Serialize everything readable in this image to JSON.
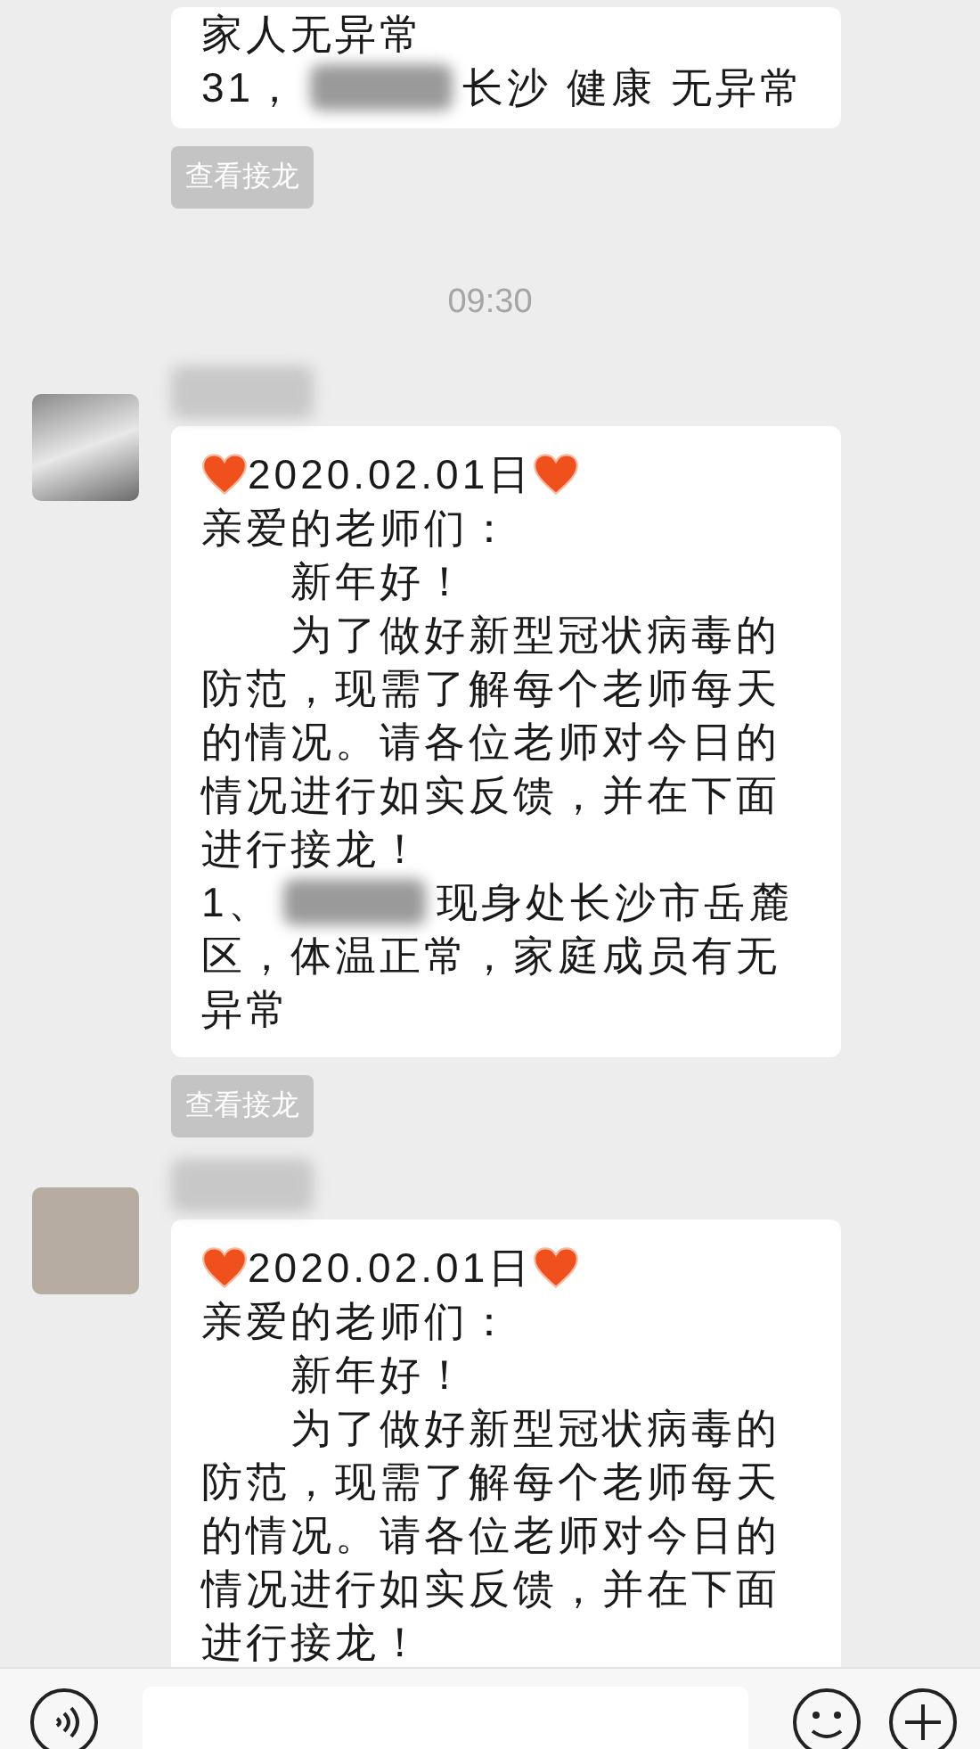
{
  "messages_top": {
    "lines": [
      {
        "kind": "text",
        "text": "家人无异常"
      },
      {
        "kind": "redacted",
        "before": "31，",
        "after": "长沙 健康 无异常"
      }
    ],
    "action": "查看接龙"
  },
  "time_stamp": "09:30",
  "messages": [
    {
      "avatar": {
        "kind": "photo"
      },
      "lines": [
        {
          "kind": "date",
          "text": "2020.02.01日"
        },
        {
          "kind": "text",
          "text": "亲爱的老师们："
        },
        {
          "kind": "text",
          "text": "新年好！",
          "indent": true
        },
        {
          "kind": "text",
          "text": "为了做好新型冠状病毒的",
          "indent": true
        },
        {
          "kind": "text",
          "text": "防范，现需了解每个老师每天"
        },
        {
          "kind": "text",
          "text": "的情况。请各位老师对今日的"
        },
        {
          "kind": "text",
          "text": "情况进行如实反馈，并在下面"
        },
        {
          "kind": "text",
          "text": "进行接龙！"
        },
        {
          "kind": "redacted",
          "before": "1、",
          "after": "现身处长沙市岳麓"
        },
        {
          "kind": "text",
          "text": "区，体温正常，家庭成员有无"
        },
        {
          "kind": "text",
          "text": "异常"
        }
      ],
      "action": "查看接龙"
    },
    {
      "avatar": {
        "kind": "drawing"
      },
      "lines": [
        {
          "kind": "date",
          "text": "2020.02.01日"
        },
        {
          "kind": "text",
          "text": "亲爱的老师们："
        },
        {
          "kind": "text",
          "text": "新年好！",
          "indent": true
        },
        {
          "kind": "text",
          "text": "为了做好新型冠状病毒的",
          "indent": true
        },
        {
          "kind": "text",
          "text": "防范，现需了解每个老师每天"
        },
        {
          "kind": "text",
          "text": "的情况。请各位老师对今日的"
        },
        {
          "kind": "text",
          "text": "情况进行如实反馈，并在下面"
        },
        {
          "kind": "text",
          "text": "进行接龙！"
        }
      ]
    }
  ]
}
